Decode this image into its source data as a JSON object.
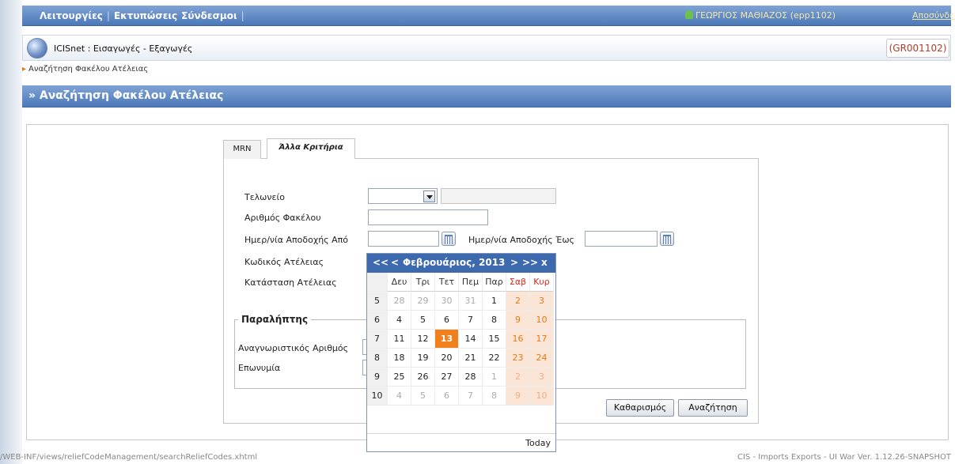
{
  "nav": {
    "menus": [
      "Λειτουργίες",
      "Εκτυπώσεις",
      "Σύνδεσμοι"
    ],
    "separator": "|",
    "user": "ΓΕΩΡΓΙΟΣ ΜΑΘΙΑΖΟΣ (epp1102)",
    "logout": "Αποσύνδεση"
  },
  "app": {
    "title": "ICISnet : Εισαγωγές - Εξαγωγές",
    "code": "(GR001102)"
  },
  "breadcrumb": "Αναζήτηση Φακέλου Ατέλειας",
  "page_title": "» Αναζήτηση Φακέλου Ατέλειας",
  "tabs": [
    {
      "label": "MRN",
      "active": false
    },
    {
      "label": "Άλλα Κριτήρια",
      "active": true
    }
  ],
  "form": {
    "customs_office": {
      "label": "Τελωνείο",
      "value": "",
      "name": ""
    },
    "file_number": {
      "label": "Αριθμός Φακέλου",
      "value": ""
    },
    "date_from": {
      "label": "Ημερ/νία Αποδοχής Από",
      "value": ""
    },
    "date_to": {
      "label": "Ημερ/νία Αποδοχής Έως",
      "value": ""
    },
    "relief_code": {
      "label": "Κωδικός Ατέλειας"
    },
    "relief_status": {
      "label": "Κατάσταση Ατέλειας"
    }
  },
  "recipient": {
    "legend": "Παραλήπτης",
    "id_label": "Αναγνωριστικός Αριθμός",
    "name_label": "Επωνυμία"
  },
  "buttons": {
    "clear": "Καθαρισμός",
    "search": "Αναζήτηση"
  },
  "calendar": {
    "nav_prev_year": "<<",
    "nav_prev_month": "<",
    "month_year": "Φεβρουάριος, 2013",
    "nav_next_month": ">",
    "nav_next_year": ">>",
    "close": "x",
    "weekdays": [
      "Δευ",
      "Τρι",
      "Τετ",
      "Πεμ",
      "Παρ",
      "Σαβ",
      "Κυρ"
    ],
    "weeks": [
      {
        "week": "5",
        "days": [
          "28",
          "29",
          "30",
          "31",
          "1",
          "2",
          "3"
        ]
      },
      {
        "week": "6",
        "days": [
          "4",
          "5",
          "6",
          "7",
          "8",
          "9",
          "10"
        ]
      },
      {
        "week": "7",
        "days": [
          "11",
          "12",
          "13",
          "14",
          "15",
          "16",
          "17"
        ]
      },
      {
        "week": "8",
        "days": [
          "18",
          "19",
          "20",
          "21",
          "22",
          "23",
          "24"
        ]
      },
      {
        "week": "9",
        "days": [
          "25",
          "26",
          "27",
          "28",
          "1",
          "2",
          "3"
        ]
      },
      {
        "week": "10",
        "days": [
          "4",
          "5",
          "6",
          "7",
          "8",
          "9",
          "10"
        ]
      }
    ],
    "selected_day": "13",
    "today_label": "Today"
  },
  "footer": {
    "path": "/WEB-INF/views/reliefCodeManagement/searchReliefCodes.xhtml",
    "version": "CIS - Imports Exports - UI War Ver. 1.12.26-SNAPSHOT"
  },
  "colors": {
    "nav_bar": "#4b78b8",
    "weekend_bg": "#fbe5d6",
    "today_bg": "#f07f1c",
    "code_text": "#b23b2a"
  }
}
